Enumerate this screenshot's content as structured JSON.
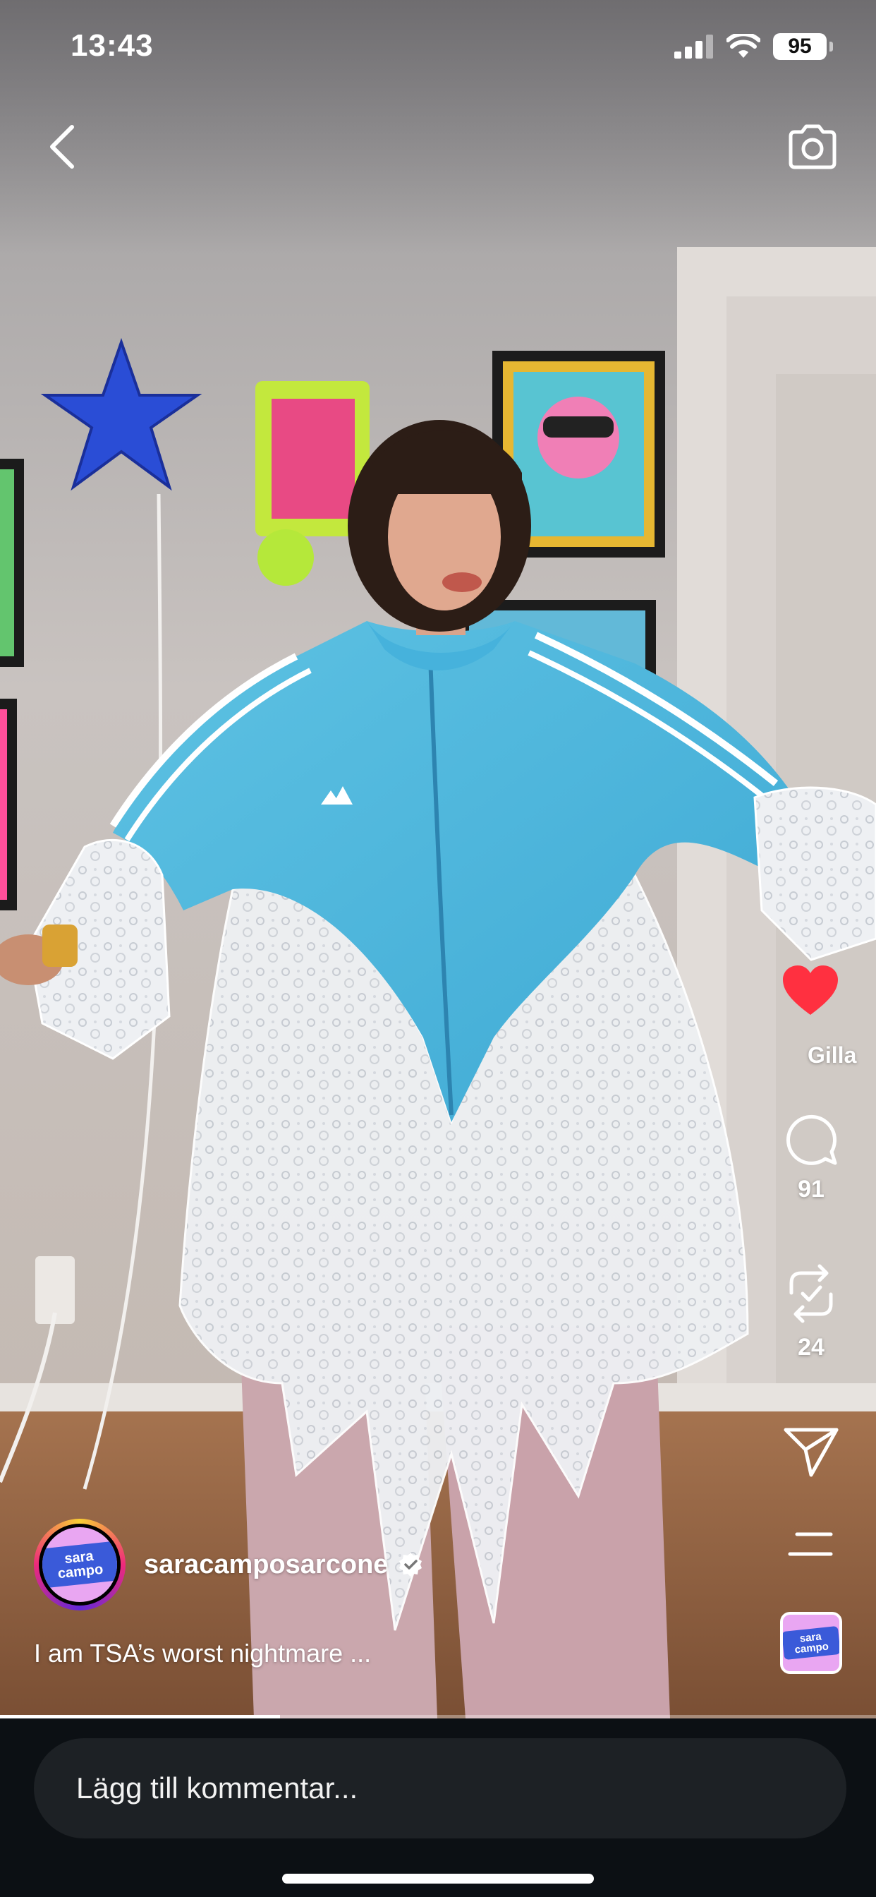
{
  "status_bar": {
    "time": "13:43",
    "battery": "95"
  },
  "nav": {
    "back_icon": "chevron-left-icon",
    "camera_icon": "camera-icon"
  },
  "actions": {
    "like": {
      "icon": "heart-filled-icon",
      "label": "Gilla",
      "liked": true,
      "color": "#ff3040"
    },
    "comment": {
      "icon": "comment-bubble-icon",
      "count": "91"
    },
    "repost": {
      "icon": "repost-icon",
      "count": "24"
    },
    "share": {
      "icon": "paper-plane-icon"
    },
    "more": {
      "icon": "menu-lines-icon"
    }
  },
  "author": {
    "username": "saracamposarcone",
    "verified": true,
    "avatar_text": "sara campo"
  },
  "caption": "I am TSA’s worst nightmare ...",
  "audio": {
    "thumbnail_text": "sara campo"
  },
  "playback": {
    "progress_percent": 32
  },
  "comment_bar": {
    "placeholder": "Lägg till kommentar..."
  }
}
